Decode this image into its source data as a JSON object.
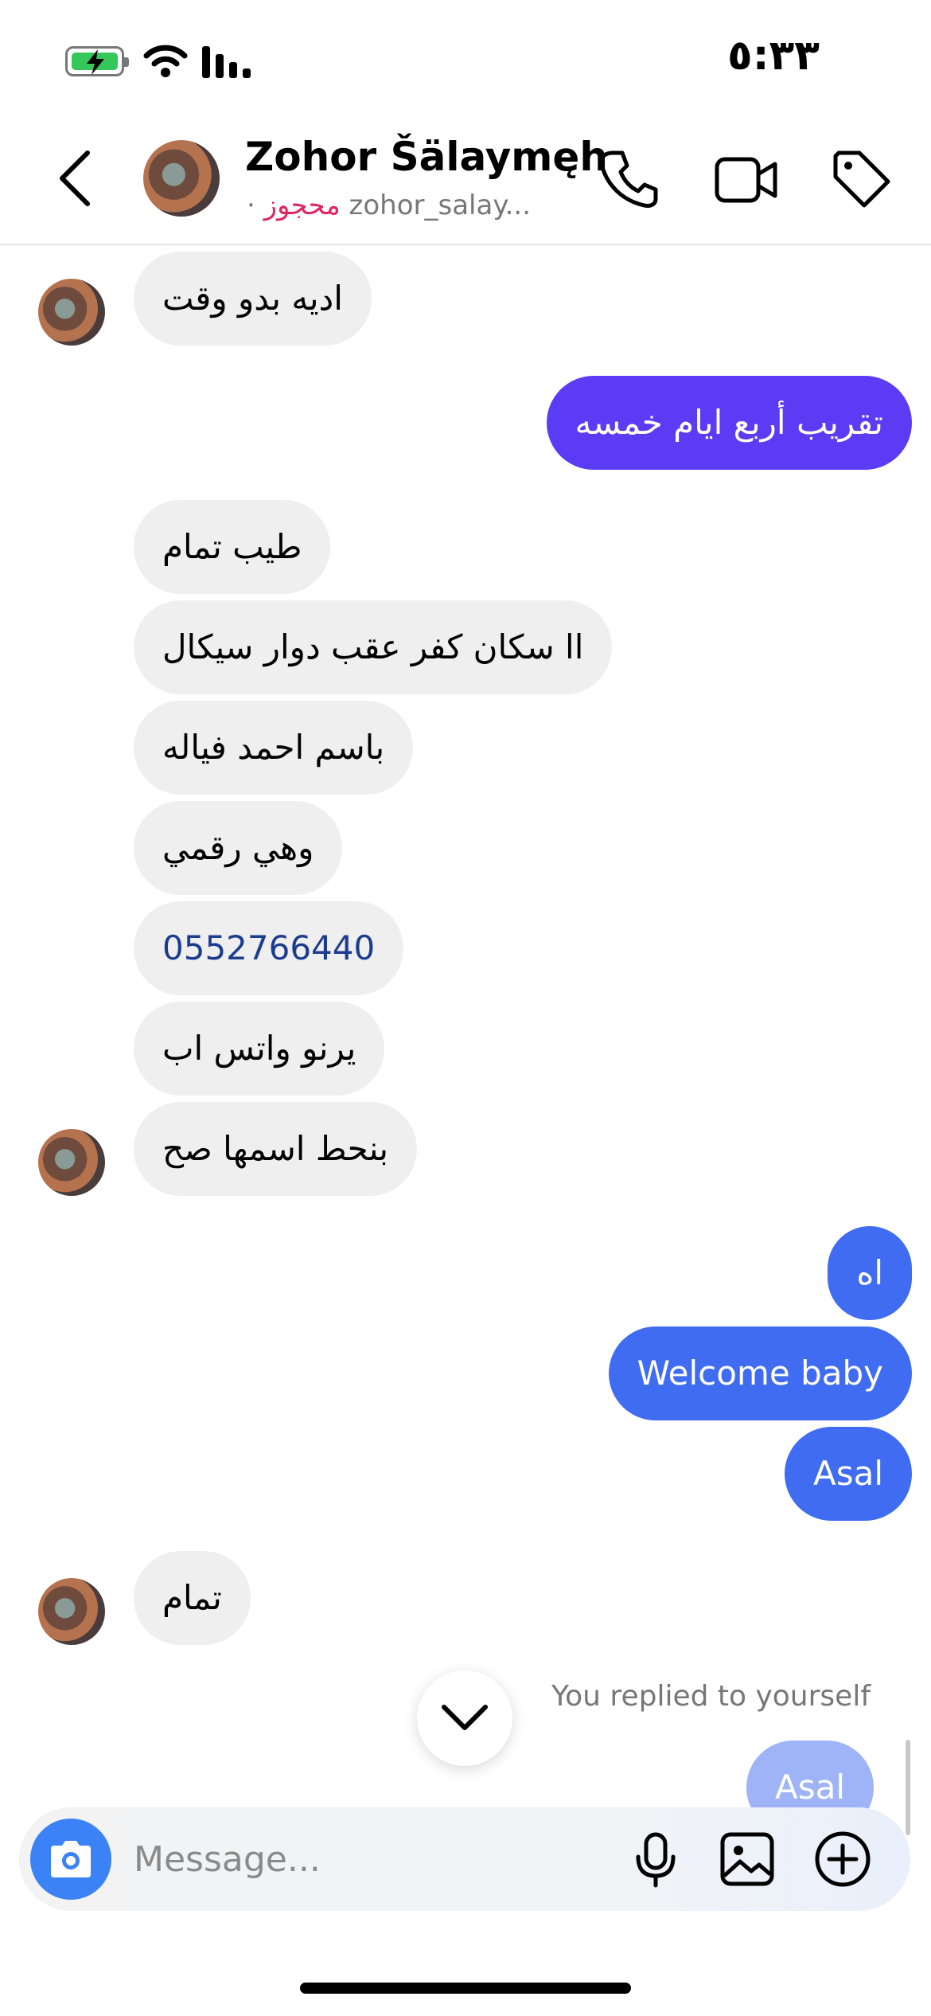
{
  "status_bar": {
    "time": "٥:٣٣",
    "icons": [
      "battery-charging-icon",
      "wifi-icon",
      "signal-icon"
    ]
  },
  "header": {
    "back_icon": "chevron-left-icon",
    "name": "Zohor Šälaymęh",
    "blocked_label": "محجوز",
    "username": "zohor_salay...",
    "separator": "·",
    "actions": [
      "phone-icon",
      "video-icon",
      "tag-icon"
    ]
  },
  "messages": [
    {
      "side": "in",
      "text": "اديه بدو وقت"
    },
    {
      "side": "out",
      "text": "تقريب أربع ايام خمسه"
    },
    {
      "side": "in",
      "text": "طيب تمام"
    },
    {
      "side": "in",
      "text": "اا سكان كفر عقب دوار سيكال"
    },
    {
      "side": "in",
      "text": "باسم احمد فياله"
    },
    {
      "side": "in",
      "text": "وهي رقمي"
    },
    {
      "side": "in",
      "text": "0552766440"
    },
    {
      "side": "in",
      "text": "يرنو واتس اب"
    },
    {
      "side": "in",
      "text": "بنحط اسمها صح"
    },
    {
      "side": "out",
      "text": "اه"
    },
    {
      "side": "out",
      "text": "Welcome baby"
    },
    {
      "side": "out",
      "text": "Asal"
    },
    {
      "side": "in",
      "text": "تمام"
    },
    {
      "side": "out",
      "text": "Asal"
    }
  ],
  "reply_note": "You replied to yourself",
  "composer": {
    "placeholder": "Message...",
    "icons": [
      "camera-icon",
      "microphone-icon",
      "gallery-icon",
      "plus-circle-icon"
    ]
  },
  "colors": {
    "outgoing": "#3f6cf0",
    "outgoing_first": "#5b3cf4",
    "incoming": "#efefef",
    "blocked": "#e0245e",
    "camera_button": "#3b82f6"
  }
}
